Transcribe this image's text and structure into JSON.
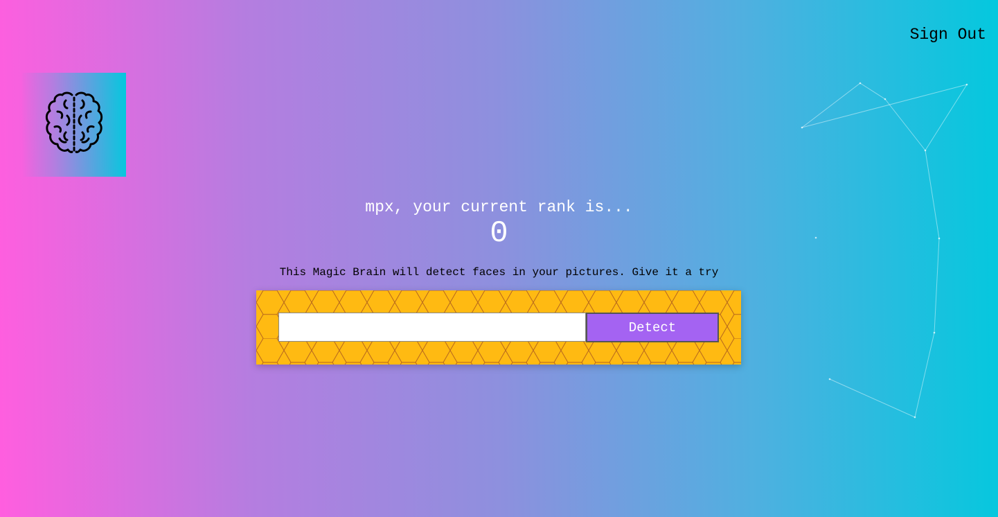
{
  "nav": {
    "sign_out_label": "Sign Out"
  },
  "logo": {
    "icon": "brain-icon"
  },
  "rank": {
    "title": "mpx, your current rank is...",
    "value": "0"
  },
  "intro": {
    "text": "This Magic Brain will detect faces in your pictures. Give it a try"
  },
  "image_form": {
    "input_value": "",
    "input_placeholder": "",
    "detect_label": "Detect"
  },
  "colors": {
    "gradient_start": "#ff5edf",
    "gradient_end": "#04c8de",
    "panel": "#ffba12",
    "button": "#a463f2"
  }
}
